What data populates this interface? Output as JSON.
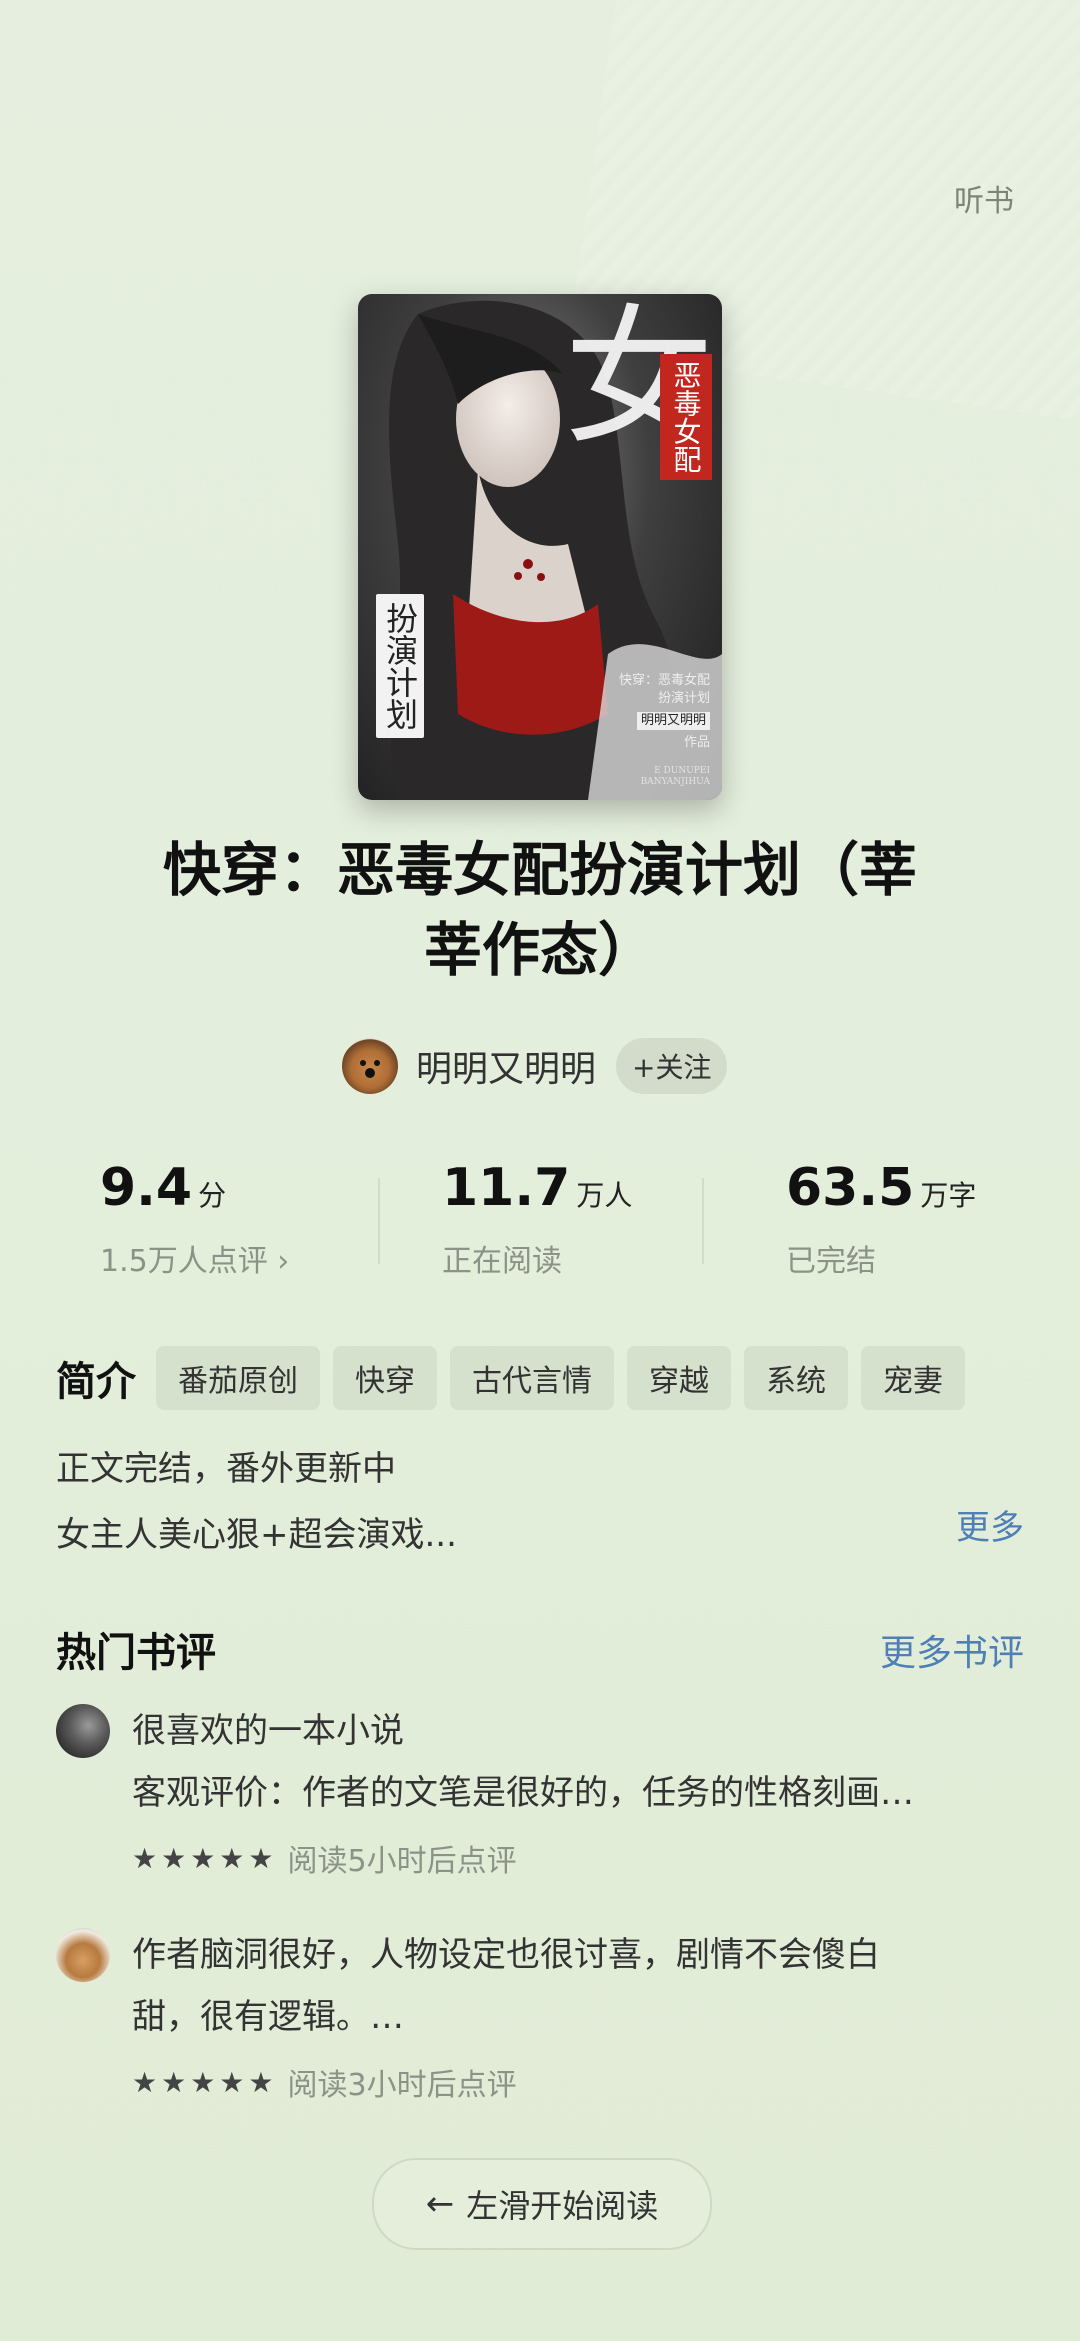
{
  "header": {
    "listen_label": "听书"
  },
  "cover": {
    "big_char": "女",
    "stamp_text": "恶毒女配",
    "left_text": "扮演计划",
    "small_line1": "快穿：恶毒女配",
    "small_line2": "扮演计划",
    "small_author": "明明又明明",
    "small_suffix": "作品",
    "small_foot1": "E DUNUPEI",
    "small_foot2": "BANYANJIHUA"
  },
  "book": {
    "title_line1": "快穿：恶毒女配扮演计划（莘",
    "title_line2": "莘作态）"
  },
  "author": {
    "name": "明明又明明",
    "follow_label": "+关注"
  },
  "stats": [
    {
      "num": "9.4",
      "unit": "分",
      "sub": "1.5万人点评 ›"
    },
    {
      "num": "11.7",
      "unit": "万人",
      "sub": "正在阅读"
    },
    {
      "num": "63.5",
      "unit": "万字",
      "sub": "已完结"
    }
  ],
  "intro": {
    "label": "简介",
    "tags": [
      "番茄原创",
      "快穿",
      "古代言情",
      "穿越",
      "系统",
      "宠妻"
    ],
    "line1": "正文完结，番外更新中",
    "line2": "女主人美心狠+超会演戏...",
    "more_label": "更多"
  },
  "reviews": {
    "heading": "热门书评",
    "more_label": "更多书评",
    "items": [
      {
        "line1": "很喜欢的一本小说",
        "line2": "客观评价：作者的文笔是很好的，任务的性格刻画…",
        "stars": "★★★★★",
        "meta": "阅读5小时后点评"
      },
      {
        "line1": "作者脑洞很好，人物设定也很讨喜，剧情不会傻白",
        "line2": "甜，很有逻辑。…",
        "stars": "★★★★★",
        "meta": "阅读3小时后点评"
      }
    ]
  },
  "start": {
    "arrow": "←",
    "label": "左滑开始阅读"
  }
}
